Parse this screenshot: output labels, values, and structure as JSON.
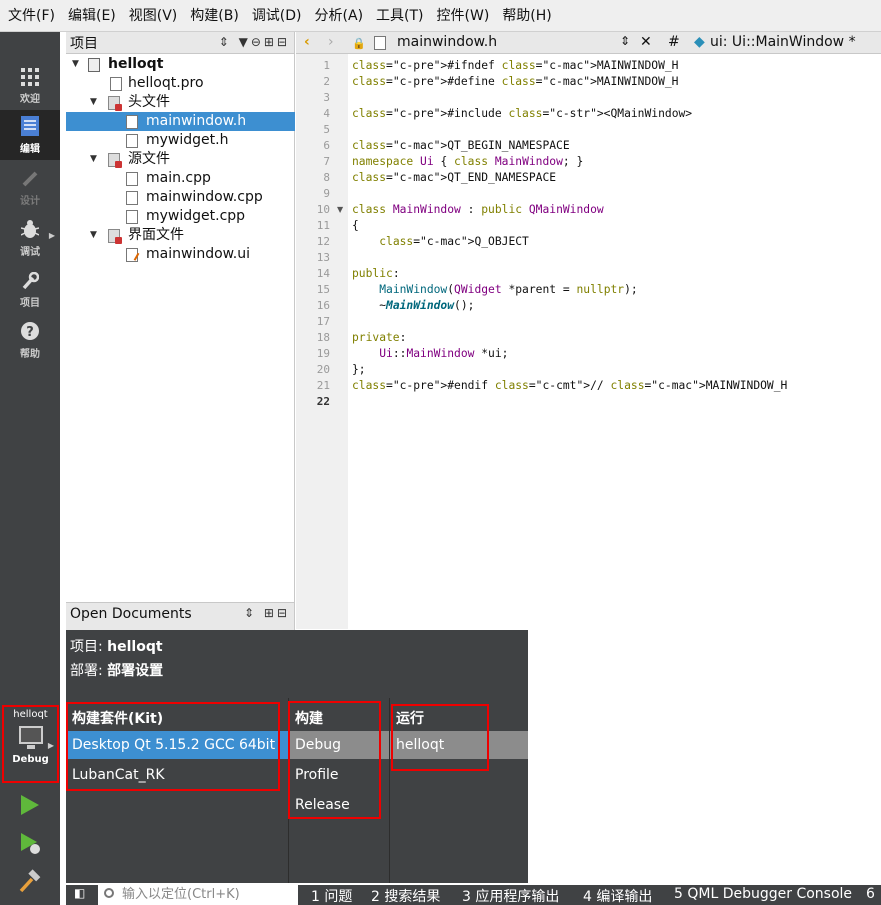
{
  "menu": [
    "文件(F)",
    "编辑(E)",
    "视图(V)",
    "构建(B)",
    "调试(D)",
    "分析(A)",
    "工具(T)",
    "控件(W)",
    "帮助(H)"
  ],
  "modes": [
    {
      "label": "欢迎",
      "icon": "grid-icon"
    },
    {
      "label": "编辑",
      "icon": "edit-doc-icon"
    },
    {
      "label": "设计",
      "icon": "pencil-icon"
    },
    {
      "label": "调试",
      "icon": "bug-icon"
    },
    {
      "label": "项目",
      "icon": "wrench-icon"
    },
    {
      "label": "帮助",
      "icon": "help-icon"
    }
  ],
  "kit_selector": {
    "project": "helloqt",
    "config": "Debug"
  },
  "projects_panel": {
    "title": "项目"
  },
  "tree": [
    {
      "label": "helloqt",
      "bold": true
    },
    {
      "label": "helloqt.pro"
    },
    {
      "label": "头文件"
    },
    {
      "label": "mainwindow.h",
      "selected": true
    },
    {
      "label": "mywidget.h"
    },
    {
      "label": "源文件"
    },
    {
      "label": "main.cpp"
    },
    {
      "label": "mainwindow.cpp"
    },
    {
      "label": "mywidget.cpp"
    },
    {
      "label": "界面文件"
    },
    {
      "label": "mainwindow.ui"
    }
  ],
  "open_documents": {
    "title": "Open Documents"
  },
  "editor": {
    "file_name": "mainwindow.h",
    "hash": "#",
    "symbol": "ui: Ui::MainWindow *",
    "current_line": "22"
  },
  "code_lines": [
    "#ifndef MAINWINDOW_H",
    "#define MAINWINDOW_H",
    "",
    "#include <QMainWindow>",
    "",
    "QT_BEGIN_NAMESPACE",
    "namespace Ui { class MainWindow; }",
    "QT_END_NAMESPACE",
    "",
    "class MainWindow : public QMainWindow",
    "{",
    "    Q_OBJECT",
    "",
    "public:",
    "    MainWindow(QWidget *parent = nullptr);",
    "    ~MainWindow();",
    "",
    "private:",
    "    Ui::MainWindow *ui;",
    "};",
    "#endif // MAINWINDOW_H",
    ""
  ],
  "line_numbers": [
    "1",
    "2",
    "3",
    "4",
    "5",
    "6",
    "7",
    "8",
    "9",
    "10",
    "11",
    "12",
    "13",
    "14",
    "15",
    "16",
    "17",
    "18",
    "19",
    "20",
    "21",
    "22"
  ],
  "kit_popup": {
    "project_label": "项目:",
    "project_value": "helloqt",
    "deploy_label": "部署:",
    "deploy_value": "部署设置",
    "kit_header": "构建套件(Kit)",
    "kits": [
      "Desktop Qt 5.15.2 GCC 64bit",
      "LubanCat_RK"
    ],
    "build_header": "构建",
    "builds": [
      "Debug",
      "Profile",
      "Release"
    ],
    "run_header": "运行",
    "runs": [
      "helloqt"
    ]
  },
  "statusbar": {
    "locator_placeholder": "输入以定位(Ctrl+K)",
    "tabs": [
      "1 问题",
      "2 搜索结果",
      "3 应用程序输出",
      "4 编译输出",
      "5 QML Debugger Console",
      "6"
    ]
  },
  "colors": {
    "accent": "#3d8fd1",
    "highlight_box": "#e00000",
    "sidebar": "#404244"
  }
}
